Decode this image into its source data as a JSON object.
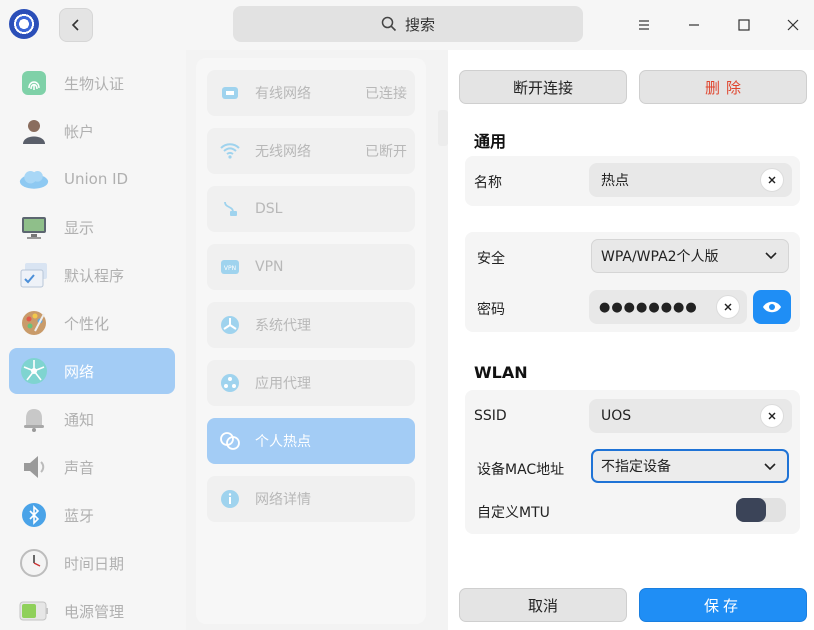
{
  "titlebar": {
    "search_label": "搜索"
  },
  "sidebar": {
    "items": [
      {
        "label": "生物认证",
        "icon": "fingerprint-icon",
        "active": false
      },
      {
        "label": "帐户",
        "icon": "account-icon",
        "active": false
      },
      {
        "label": "Union ID",
        "icon": "cloud-icon",
        "active": false
      },
      {
        "label": "显示",
        "icon": "display-icon",
        "active": false
      },
      {
        "label": "默认程序",
        "icon": "default-apps-icon",
        "active": false
      },
      {
        "label": "个性化",
        "icon": "palette-icon",
        "active": false
      },
      {
        "label": "网络",
        "icon": "network-icon",
        "active": true
      },
      {
        "label": "通知",
        "icon": "bell-icon",
        "active": false
      },
      {
        "label": "声音",
        "icon": "speaker-icon",
        "active": false
      },
      {
        "label": "蓝牙",
        "icon": "bluetooth-icon",
        "active": false
      },
      {
        "label": "时间日期",
        "icon": "clock-icon",
        "active": false
      },
      {
        "label": "电源管理",
        "icon": "battery-icon",
        "active": false
      }
    ]
  },
  "network_menu": {
    "items": [
      {
        "label": "有线网络",
        "status": "已连接",
        "icon": "wired-icon"
      },
      {
        "label": "无线网络",
        "status": "已断开",
        "icon": "wifi-icon"
      },
      {
        "label": "DSL",
        "status": "",
        "icon": "dsl-icon"
      },
      {
        "label": "VPN",
        "status": "",
        "icon": "vpn-icon"
      },
      {
        "label": "系统代理",
        "status": "",
        "icon": "system-proxy-icon"
      },
      {
        "label": "应用代理",
        "status": "",
        "icon": "app-proxy-icon"
      },
      {
        "label": "个人热点",
        "status": "",
        "icon": "hotspot-icon",
        "active": true
      },
      {
        "label": "网络详情",
        "status": "",
        "icon": "info-icon"
      }
    ]
  },
  "hotspot": {
    "disconnect_label": "断开连接",
    "delete_label": "删除",
    "general": {
      "title": "通用",
      "name_label": "名称",
      "name_value": "热点"
    },
    "security": {
      "label": "安全",
      "value": "WPA/WPA2个人版",
      "password_label": "密码",
      "password_mask": "●●●●●●●●"
    },
    "wlan": {
      "title": "WLAN",
      "ssid_label": "SSID",
      "ssid_value": "UOS",
      "mac_label": "设备MAC地址",
      "mac_value": "不指定设备",
      "mtu_label": "自定义MTU",
      "mtu_enabled": false
    },
    "cancel_label": "取消",
    "save_label": "保存"
  },
  "colors": {
    "accent": "#1f8ef5",
    "selection": "#a3ccf5",
    "danger": "#e0452e"
  }
}
